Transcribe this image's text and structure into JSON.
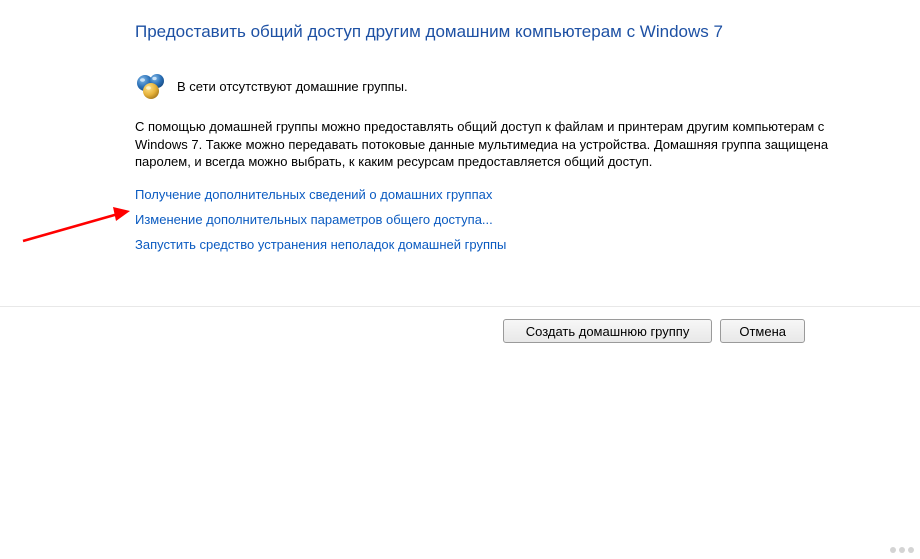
{
  "title": "Предоставить общий доступ другим домашним компьютерам с Windows 7",
  "status": {
    "icon": "homegroup-network-icon",
    "text": "В сети отсутствуют домашние группы."
  },
  "description": "С помощью домашней группы можно предоставлять общий доступ к файлам и принтерам другим компьютерам с Windows 7. Также можно передавать потоковые данные мультимедиа на устройства. Домашняя группа защищена паролем, и всегда можно выбрать, к каким ресурсам предоставляется общий доступ.",
  "links": [
    {
      "label": "Получение дополнительных сведений о домашних группах"
    },
    {
      "label": "Изменение дополнительных параметров общего доступа..."
    },
    {
      "label": "Запустить средство устранения неполадок домашней группы"
    }
  ],
  "buttons": {
    "create": "Создать домашнюю группу",
    "cancel": "Отмена"
  },
  "colors": {
    "title": "#1e51a4",
    "link": "#0b5bc1",
    "arrow": "#ff0000"
  }
}
